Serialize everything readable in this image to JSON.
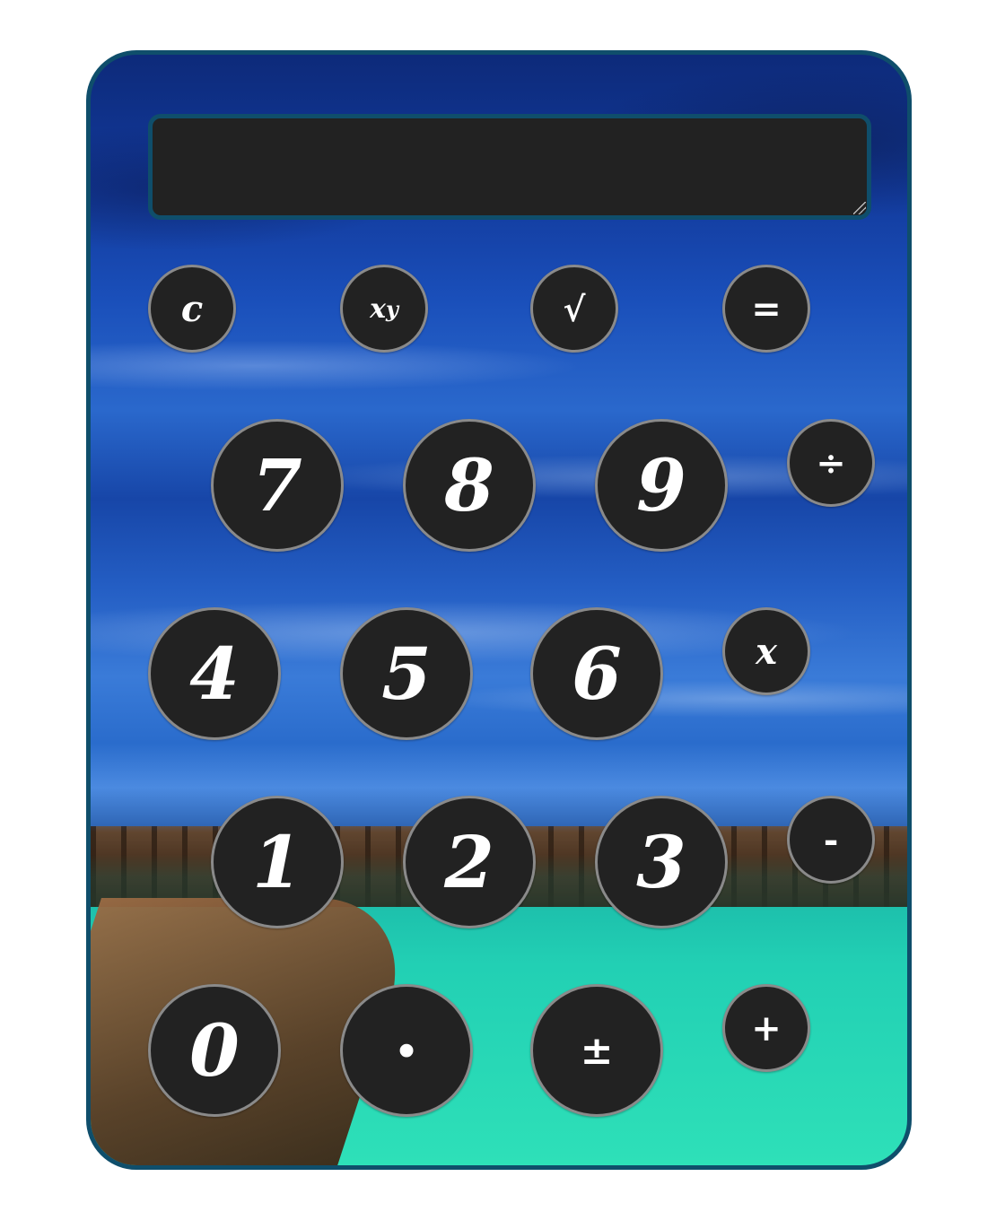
{
  "display": {
    "value": ""
  },
  "buttons": {
    "clear": "c",
    "power_base": "x",
    "power_exp": "y",
    "sqrt": "√",
    "equals": "=",
    "seven": "7",
    "eight": "8",
    "nine": "9",
    "divide": "÷",
    "four": "4",
    "five": "5",
    "six": "6",
    "multiply": "x",
    "one": "1",
    "two": "2",
    "three": "3",
    "subtract": "-",
    "zero": "0",
    "decimal": "·",
    "plus_minus": "±",
    "add": "+"
  },
  "colors": {
    "frame_border": "#0f4e6b",
    "button_face": "#222222",
    "button_ring": "#8a8a8a",
    "button_text": "#ffffff",
    "display_background": "#222222"
  }
}
